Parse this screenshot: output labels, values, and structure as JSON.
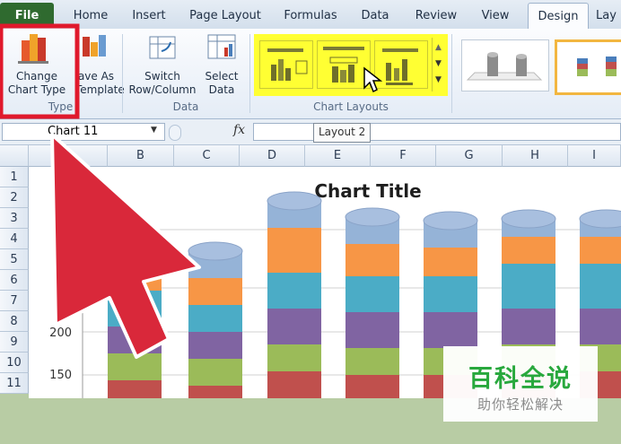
{
  "tabs": [
    {
      "label": "File"
    },
    {
      "label": "Home"
    },
    {
      "label": "Insert"
    },
    {
      "label": "Page Layout"
    },
    {
      "label": "Formulas"
    },
    {
      "label": "Data"
    },
    {
      "label": "Review"
    },
    {
      "label": "View"
    },
    {
      "label": "Design"
    },
    {
      "label": "Lay"
    }
  ],
  "ribbon": {
    "change_chart_type": "Change\nChart Type",
    "save_as_template": "ave As\nTemplate",
    "switch_row_column": "Switch\nRow/Column",
    "select_data": "Select\nData",
    "group_type": "Type",
    "group_data": "Data",
    "group_chart_layouts": "Chart Layouts"
  },
  "formula_bar": {
    "name_box": "Chart 11",
    "fx": "fx",
    "tooltip": "Layout 2"
  },
  "columns": [
    "B",
    "C",
    "D",
    "E",
    "F",
    "G",
    "H",
    "I"
  ],
  "rows": [
    "1",
    "2",
    "3",
    "4",
    "5",
    "6",
    "7",
    "8",
    "9",
    "10",
    "11"
  ],
  "chart_data": {
    "type": "bar",
    "title": "Chart Title",
    "yticks": [
      "200",
      "150"
    ],
    "series_colors": [
      "#c0504d",
      "#9bbb59",
      "#8064a2",
      "#4bacc6",
      "#f79646",
      "#95b3d7"
    ]
  },
  "watermark": {
    "main": "百科全说",
    "sub": "助你轻松解决"
  },
  "colors": {
    "highlight_yellow": "#ffff33",
    "arrow_red": "#d9283a",
    "selection_red": "#e0192c"
  }
}
